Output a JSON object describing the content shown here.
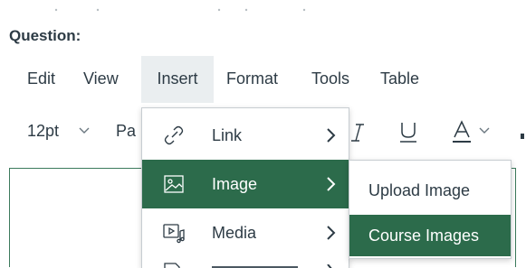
{
  "question_label": "Question:",
  "menubar": {
    "items": [
      "Edit",
      "View",
      "Insert",
      "Format",
      "Tools",
      "Table"
    ],
    "active": "Insert"
  },
  "toolbar": {
    "font_size": "12pt",
    "paragraph_partial": "Pa"
  },
  "insert_menu": {
    "items": [
      {
        "label": "Link",
        "icon": "link-icon",
        "has_submenu": true
      },
      {
        "label": "Image",
        "icon": "image-icon",
        "has_submenu": true,
        "selected": true
      },
      {
        "label": "Media",
        "icon": "media-icon",
        "has_submenu": true
      }
    ]
  },
  "image_submenu": {
    "items": [
      {
        "label": "Upload Image"
      },
      {
        "label": "Course Images",
        "selected": true
      }
    ]
  },
  "colors": {
    "accent": "#2c6b4b",
    "editor_border": "#3c7a5c",
    "text": "#2d3b45",
    "menu_active_bg": "#eaeef0"
  }
}
